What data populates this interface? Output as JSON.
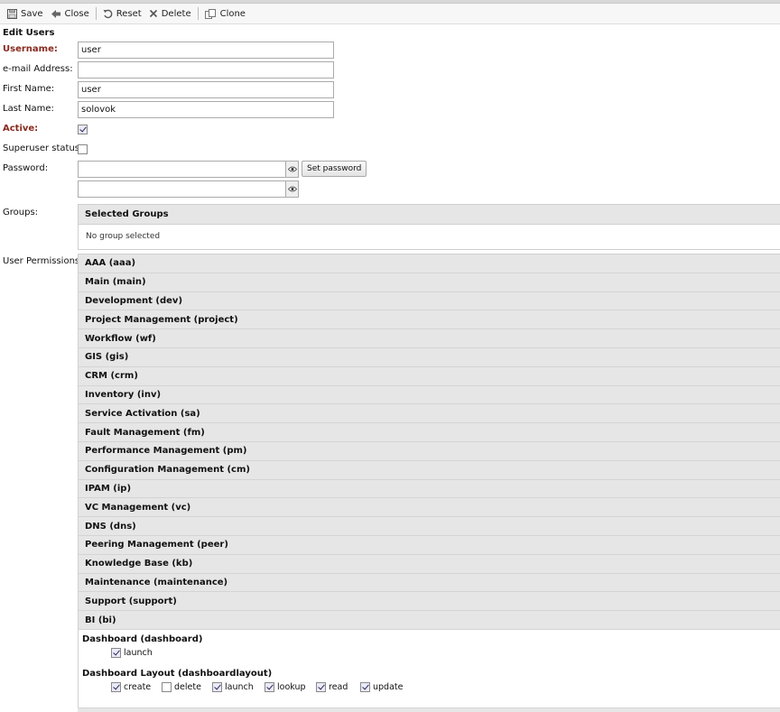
{
  "toolbar": {
    "save": "Save",
    "close": "Close",
    "reset": "Reset",
    "delete": "Delete",
    "clone": "Clone"
  },
  "form": {
    "heading": "Edit Users",
    "username_label": "Username:",
    "username_value": "user",
    "email_label": "e-mail Address:",
    "email_value": "",
    "first_name_label": "First Name:",
    "first_name_value": "user",
    "last_name_label": "Last Name:",
    "last_name_value": "solovok",
    "active_label": "Active:",
    "active_checked": true,
    "superuser_label": "Superuser status:",
    "superuser_checked": false,
    "password_label": "Password:",
    "set_password_label": "Set password",
    "groups_label": "Groups:",
    "user_permissions_label": "User Permissions:"
  },
  "groups": {
    "header": "Selected Groups",
    "empty_text": "No group selected"
  },
  "permissions": {
    "modules": [
      "AAA (aaa)",
      "Main (main)",
      "Development (dev)",
      "Project Management (project)",
      "Workflow (wf)",
      "GIS (gis)",
      "CRM (crm)",
      "Inventory (inv)",
      "Service Activation (sa)",
      "Fault Management (fm)",
      "Performance Management (pm)",
      "Configuration Management (cm)",
      "IPAM (ip)",
      "VC Management (vc)",
      "DNS (dns)",
      "Peering Management (peer)",
      "Knowledge Base (kb)",
      "Maintenance (maintenance)",
      "Support (support)",
      "BI (bi)"
    ],
    "dashboard": {
      "title": "Dashboard (dashboard)",
      "items": [
        {
          "label": "launch",
          "checked": true
        }
      ]
    },
    "dashboard_layout": {
      "title": "Dashboard Layout (dashboardlayout)",
      "items": [
        {
          "label": "create",
          "checked": true
        },
        {
          "label": "delete",
          "checked": false
        },
        {
          "label": "launch",
          "checked": true
        },
        {
          "label": "lookup",
          "checked": true
        },
        {
          "label": "read",
          "checked": true
        },
        {
          "label": "update",
          "checked": true
        }
      ]
    }
  }
}
